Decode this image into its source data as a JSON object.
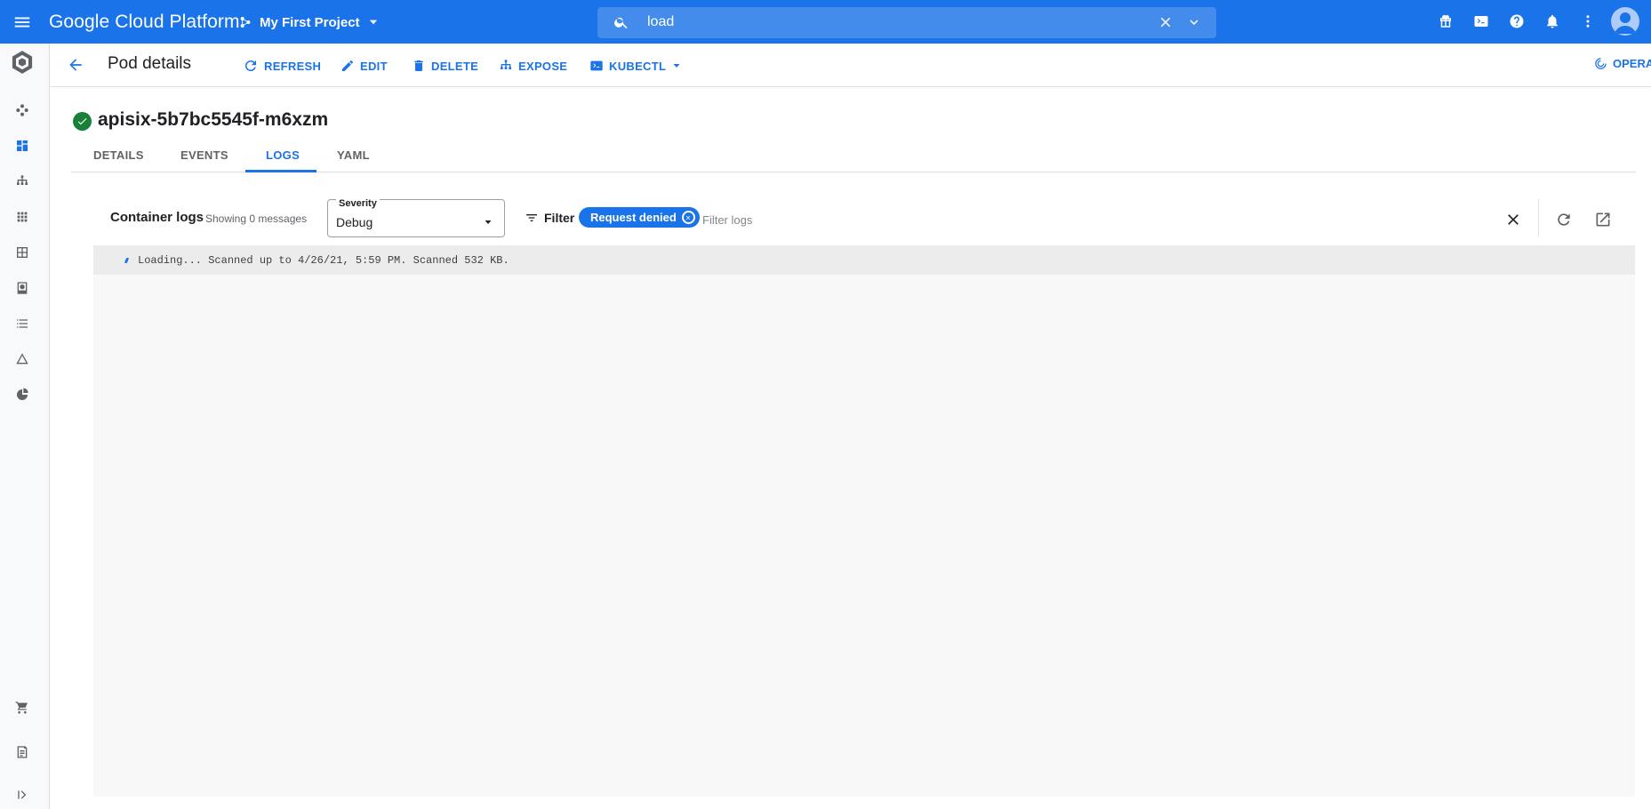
{
  "topbar": {
    "brand": "Google Cloud Platform",
    "project": "My First Project",
    "search_value": "load"
  },
  "toolbar": {
    "page_title": "Pod details",
    "refresh_label": "REFRESH",
    "edit_label": "EDIT",
    "delete_label": "DELETE",
    "expose_label": "EXPOSE",
    "kubectl_label": "KUBECTL",
    "operations_label": "OPERATIONS"
  },
  "pod": {
    "name": "apisix-5b7bc5545f-m6xzm",
    "status_color": "#188038"
  },
  "tabs": [
    {
      "label": "DETAILS"
    },
    {
      "label": "EVENTS"
    },
    {
      "label": "LOGS"
    },
    {
      "label": "YAML"
    }
  ],
  "logs": {
    "title": "Container logs",
    "count_text": "Showing 0 messages",
    "severity_label": "Severity",
    "severity_value": "Debug",
    "filter_label": "Filter",
    "chip_label": "Request denied",
    "filter_placeholder": "Filter logs",
    "status_line": "Loading... Scanned up to 4/26/21, 5:59 PM. Scanned 532 KB."
  },
  "colors": {
    "accent": "#1a73e8",
    "success": "#188038"
  }
}
